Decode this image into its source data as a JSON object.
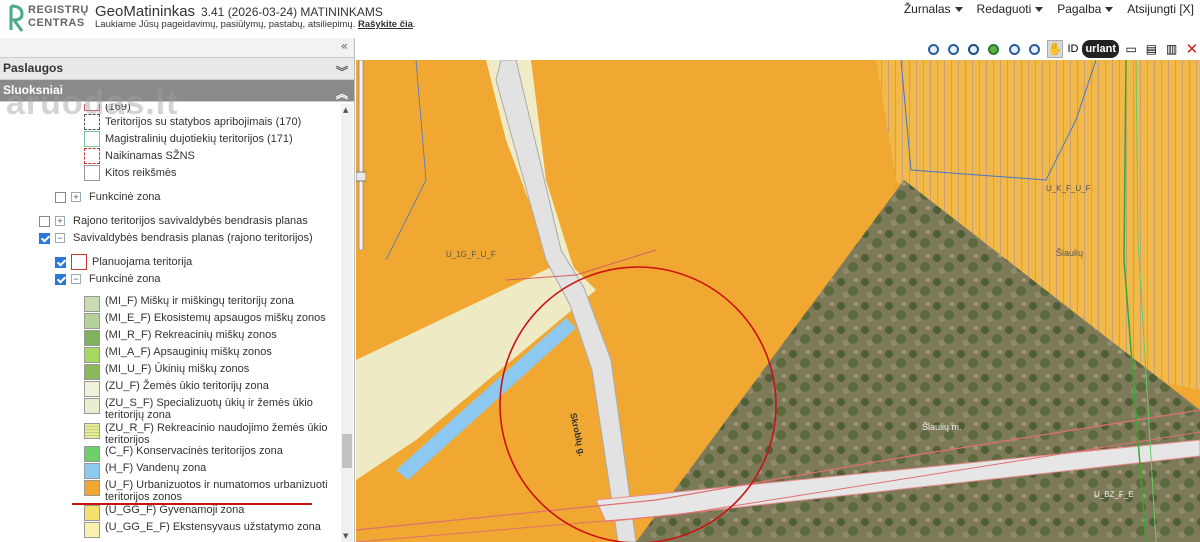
{
  "header": {
    "logo_line1": "REGISTRŲ",
    "logo_line2": "CENTRAS",
    "app_title": "GeoMatininkas",
    "app_version": "3.41 (2026-03-24) MATININKAMS",
    "subtitle": "Laukiame Jūsų pageidavimų, pasiūlymų, pastabų, atsiliepimų.",
    "subtitle_link": "Rašykite čia",
    "menu": [
      {
        "label": "Žurnalas",
        "has_caret": true
      },
      {
        "label": "Redaguoti",
        "has_caret": true
      },
      {
        "label": "Pagalba",
        "has_caret": true
      },
      {
        "label": "Atsijungti [X]",
        "has_caret": false
      }
    ]
  },
  "watermark": "aruodas.lt",
  "panel": {
    "sections": [
      {
        "label": "Paslaugos",
        "icon": "double-chevron-down-icon"
      },
      {
        "label": "Sluoksniai",
        "icon": "double-chevron-up-icon"
      }
    ],
    "collapse_icon": "double-chevron-left-icon",
    "layers": [
      {
        "label": "(169)",
        "swatch": "#ffffff",
        "swatch_border": "#d06060"
      },
      {
        "label": "Teritorijos su statybos apribojimais (170)",
        "swatch": "#ffffff",
        "swatch_border": "#555555"
      },
      {
        "label": "Magistralinių dujotiekių teritorijos (171)",
        "swatch": "#ffffff",
        "swatch_border": "#7ec8a0"
      },
      {
        "label": "Naikinamas SŽNS",
        "swatch": "#ffffff",
        "swatch_border": "#cc3333"
      },
      {
        "label": "Kitos reikšmės",
        "swatch": "#ffffff",
        "swatch_border": "#999999"
      }
    ],
    "tree": [
      {
        "label": "Funkcinė zona",
        "checked": false,
        "expander": "+"
      },
      {
        "label": "Rajono teritorijos savivaldybės bendrasis planas",
        "checked": false,
        "expander": "+"
      },
      {
        "label": "Savivaldybės bendrasis planas (rajono teritorijos)",
        "checked": true,
        "expander": "−"
      },
      {
        "label": "Planuojama teritorija",
        "checked": true,
        "expander": ""
      },
      {
        "label": "Funkcinė zona",
        "checked": true,
        "expander": "−"
      }
    ],
    "legend": [
      {
        "label": "(MI_F) Miškų ir miškingų teritorijų zona",
        "color": "#c8dcb0"
      },
      {
        "label": "(MI_E_F) Ekosistemų apsaugos miškų zonos",
        "color": "#b4d19a"
      },
      {
        "label": "(MI_R_F) Rekreacinių miškų zonos",
        "color": "#7fb25c"
      },
      {
        "label": "(MI_A_F) Apsauginių miškų zonos",
        "color": "#a8d860"
      },
      {
        "label": "(MI_U_F) Ūkinių miškų zonos",
        "color": "#8ab85a"
      },
      {
        "label": "(ZU_F) Žemės ūkio teritorijų zona",
        "color": "#eef2d6"
      },
      {
        "label": "(ZU_S_F) Specializuotų ūkių ir žemės ūkio teritorijų zona",
        "color": "#e8eed0"
      },
      {
        "label": "(ZU_R_F) Rekreacinio naudojimo žemės ūkio teritorijos",
        "color": "#e4ec9c"
      },
      {
        "label": "(C_F) Konservacinės teritorijos zona",
        "color": "#6fcf6a"
      },
      {
        "label": "(H_F) Vandenų zona",
        "color": "#8cc8ef"
      },
      {
        "label": "(U_F) Urbanizuotos ir numatomos urbanizuoti teritorijos zonos",
        "color": "#f0a832"
      },
      {
        "label": "(U_GG_F) Gyvenamoji zona",
        "color": "#f5e06e"
      },
      {
        "label": "(U_GG_E_F) Ekstensyvaus užstatymo zona",
        "color": "#faf0b0"
      }
    ]
  },
  "toolbar": {
    "id_label": "ID",
    "urlant_label": "urlant",
    "tools": [
      "zoom-in-icon",
      "zoom-out-icon",
      "zoom-extent-icon",
      "globe-icon",
      "zoom-previous-icon",
      "zoom-next-icon",
      "pan-hand-icon"
    ],
    "right_tools": [
      "ruler-icon",
      "print-icon",
      "save-icon",
      "close-red-icon"
    ]
  },
  "map": {
    "labels": [
      "U_1G_F_U_F",
      "U_K_F_U_F",
      "Šiaulių",
      "Skroblų g.",
      "Šiaulių m.",
      "U_BZ_F_E"
    ],
    "colors": {
      "urban": "#f0a832",
      "urban_hatched": "#f2b848",
      "light_zone": "#f0ecc8",
      "road": "#e6e6e6",
      "water": "#8cc8ef",
      "forest_photo": "#6e7a4e",
      "circle": "#cc1111",
      "annotation_line": "#cc1111"
    }
  }
}
